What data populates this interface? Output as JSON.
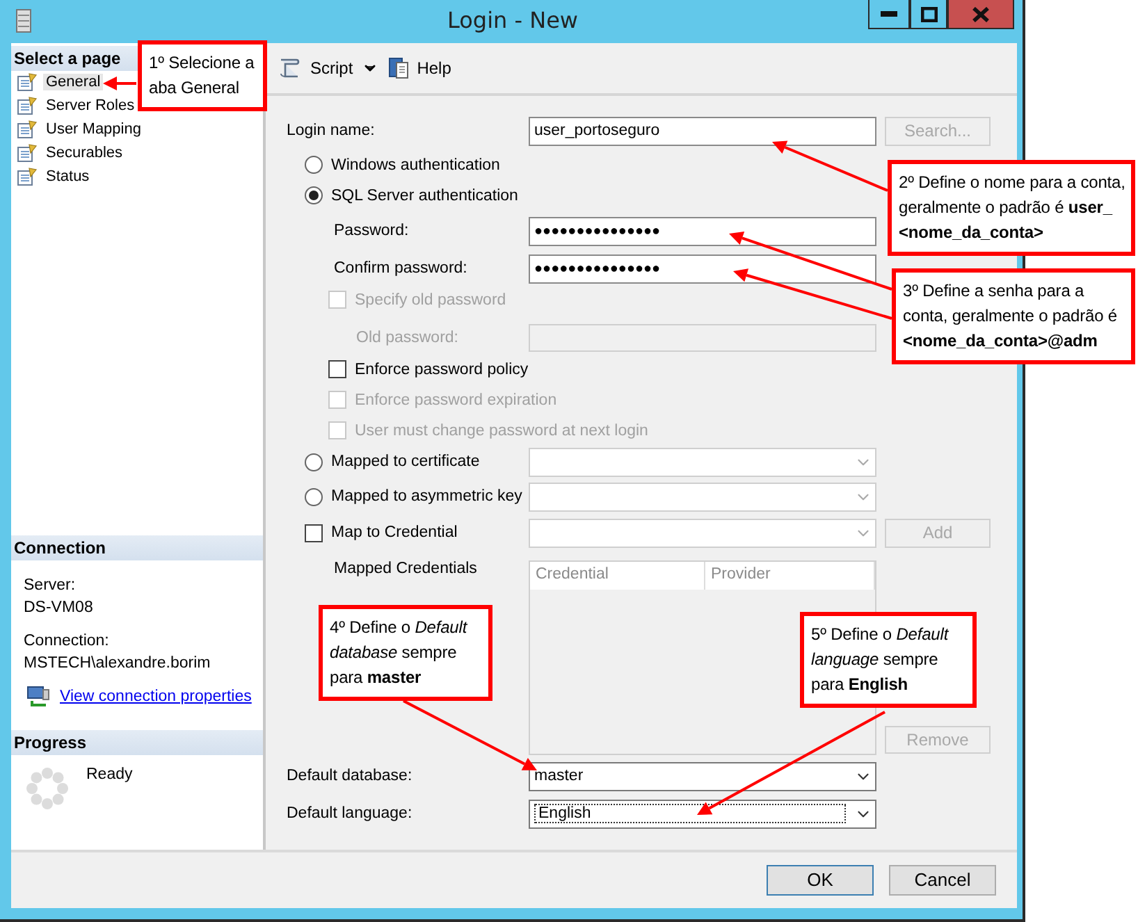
{
  "window": {
    "title": "Login - New"
  },
  "sidebar": {
    "header": "Select a page",
    "pages": [
      {
        "label": "General",
        "selected": true
      },
      {
        "label": "Server Roles",
        "selected": false
      },
      {
        "label": "User Mapping",
        "selected": false
      },
      {
        "label": "Securables",
        "selected": false
      },
      {
        "label": "Status",
        "selected": false
      }
    ],
    "connection": {
      "header": "Connection",
      "server_label": "Server:",
      "server": "DS-VM08",
      "connection_label": "Connection:",
      "connection": "MSTECH\\alexandre.borim",
      "link": "View connection properties"
    },
    "progress": {
      "header": "Progress",
      "status": "Ready"
    }
  },
  "toolbar": {
    "script": "Script",
    "help": "Help"
  },
  "form": {
    "login_name": {
      "label": "Login name:",
      "value": "user_portoseguro"
    },
    "search_button": {
      "label": "Search...",
      "disabled": true
    },
    "auth_options": [
      {
        "label": "Windows authentication",
        "selected": false
      },
      {
        "label": "SQL Server authentication",
        "selected": true
      }
    ],
    "password": {
      "label": "Password:",
      "value": "●●●●●●●●●●●●●●●"
    },
    "confirm_password": {
      "label": "Confirm password:",
      "value": "●●●●●●●●●●●●●●●"
    },
    "specify_old_password": {
      "label": "Specify old password",
      "checked": false,
      "disabled": true
    },
    "old_password": {
      "label": "Old password:",
      "disabled": true
    },
    "policies": [
      {
        "label": "Enforce password policy",
        "checked": false,
        "disabled": false
      },
      {
        "label": "Enforce password expiration",
        "checked": false,
        "disabled": true
      },
      {
        "label": "User must change password at next login",
        "checked": false,
        "disabled": true
      }
    ],
    "mapping_options": [
      {
        "label": "Mapped to certificate",
        "selected": false
      },
      {
        "label": "Mapped to asymmetric key",
        "selected": false
      }
    ],
    "map_to_credential": {
      "label": "Map to Credential",
      "checked": false
    },
    "add_button": {
      "label": "Add",
      "disabled": true
    },
    "mapped_credentials": {
      "label": "Mapped Credentials",
      "columns": [
        "Credential",
        "Provider"
      ]
    },
    "remove_button": {
      "label": "Remove",
      "disabled": true
    },
    "default_database": {
      "label": "Default database:",
      "value": "master"
    },
    "default_language": {
      "label": "Default language:",
      "value": "English"
    }
  },
  "buttons": [
    "OK",
    "Cancel"
  ],
  "callouts": [
    {
      "text": "1º Selecione a aba General"
    },
    {
      "text": "2º Define o nome para a conta, geralmente o padrão é **user_ <nome_da_conta>**"
    },
    {
      "text": "3º Define a senha para a conta, geralmente o padrão é **<nome_da_conta>@adm**"
    },
    {
      "text": "4º Define o *Default database* sempre para **master**"
    },
    {
      "text": "5º Define o *Default language* sempre para **English**"
    }
  ]
}
